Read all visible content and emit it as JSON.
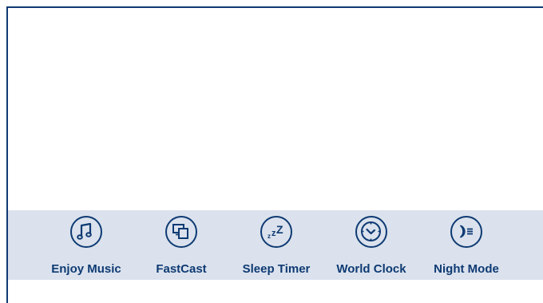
{
  "app_bar": {
    "items": [
      {
        "label": "Enjoy Music",
        "icon": "music-note-icon"
      },
      {
        "label": "FastCast",
        "icon": "screen-cast-icon"
      },
      {
        "label": "Sleep Timer",
        "icon": "sleep-zzz-icon"
      },
      {
        "label": "World Clock",
        "icon": "clock-icon"
      },
      {
        "label": "Night Mode",
        "icon": "moon-icon"
      }
    ]
  },
  "colors": {
    "accent": "#0e3a73",
    "bar_background": "#dbe2ed",
    "page_background": "#ffffff"
  }
}
